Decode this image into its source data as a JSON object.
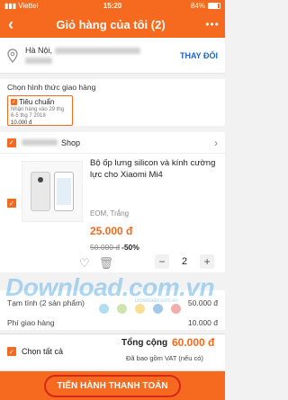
{
  "status": {
    "carrier": "Viettel",
    "time": "15:20",
    "battery": "84%",
    "battery_level": 0.84
  },
  "header": {
    "title": "Giỏ hàng của tôi (2)"
  },
  "address": {
    "city": "Hà Nội,",
    "change_label": "THAY ĐỔI"
  },
  "shipping": {
    "title": "Chọn hình thức giao hàng",
    "option_name": "Tiêu chuẩn",
    "option_desc": "Nhận hàng vào 29 thg 6-5 thg 7 2018",
    "option_fee": "10.000 đ"
  },
  "shop": {
    "label": "Shop"
  },
  "product": {
    "name": "Bộ ốp lưng silicon và kính cường lực cho Xiaomi Mi4",
    "variant": "EOM, Trắng",
    "price": "25.000 đ",
    "old_price": "50.000 đ",
    "discount": "-50%",
    "quantity": "2"
  },
  "summary": {
    "subtotal_label": "Tạm tính (2 sản phẩm)",
    "subtotal_value": "50.000 đ",
    "ship_label": "Phí giao hàng",
    "ship_value": "10.000 đ",
    "select_all": "Chọn tất cả",
    "total_label": "Tổng cộng",
    "total_value": "60.000 đ",
    "vat_note": "Đã bao gồm VAT (nếu có)"
  },
  "checkout": {
    "label": "TIẾN HÀNH THANH TOÁN"
  },
  "watermark": {
    "text": "Download.com.vn",
    "sub": "Download.com.vn"
  },
  "colors": {
    "accent": "#f56a1f",
    "link": "#1a66c9",
    "checkout_ring": "#d9261c"
  }
}
